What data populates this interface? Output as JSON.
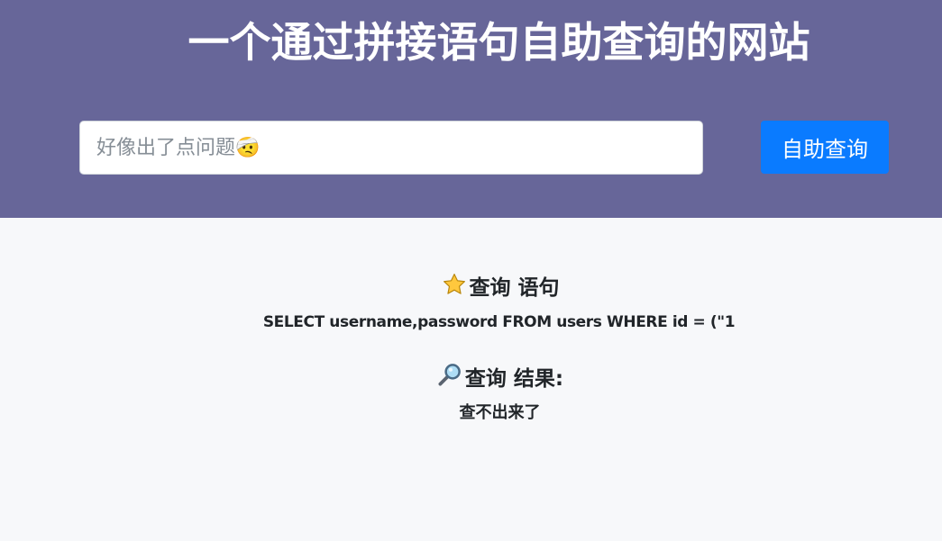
{
  "header": {
    "title": "一个通过拼接语句自助查询的网站",
    "background_color": "#676699"
  },
  "search": {
    "placeholder": "好像出了点问题🤕",
    "value": "",
    "button_label": "自助查询",
    "button_color": "#0a7bff"
  },
  "query_section": {
    "icon": "star-icon",
    "heading": "查询 语句",
    "sql": "SELECT username,password FROM users WHERE id = (\"1"
  },
  "result_section": {
    "icon": "magnifier-icon",
    "heading": "查询 结果:",
    "text": "查不出来了"
  }
}
